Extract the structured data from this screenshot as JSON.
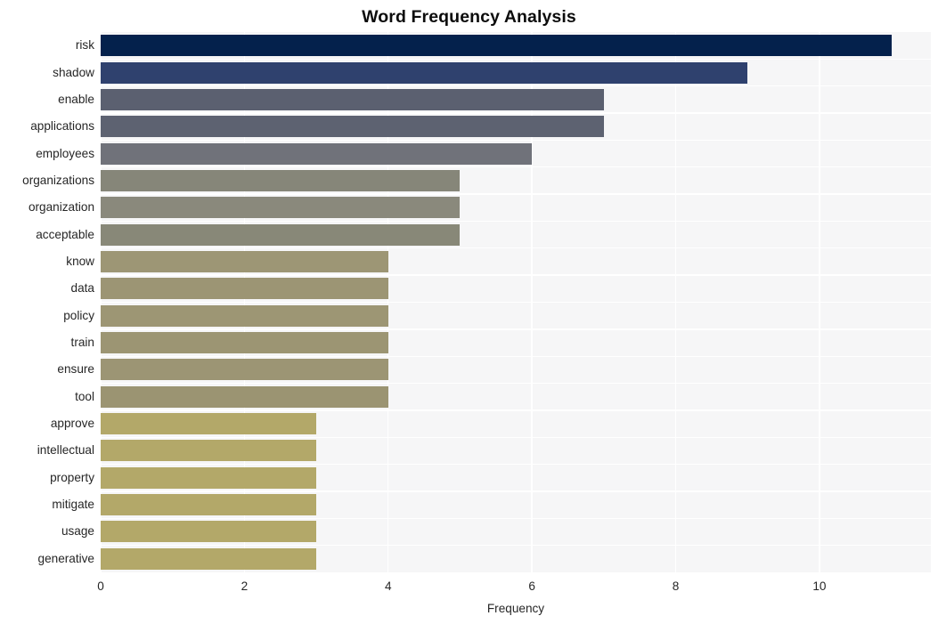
{
  "chart_data": {
    "type": "bar",
    "orientation": "horizontal",
    "title": "Word Frequency Analysis",
    "xlabel": "Frequency",
    "ylabel": "",
    "xlim": [
      0,
      11.55
    ],
    "xticks": [
      0,
      2,
      4,
      6,
      8,
      10
    ],
    "xticklabels": [
      "0",
      "2",
      "4",
      "6",
      "8",
      "10"
    ],
    "grid": "vertical-only",
    "legend": null,
    "background": "#f6f6f7",
    "gridline_color": "#ffffff",
    "categories": [
      "risk",
      "shadow",
      "enable",
      "applications",
      "employees",
      "organizations",
      "organization",
      "acceptable",
      "know",
      "data",
      "policy",
      "train",
      "ensure",
      "tool",
      "approve",
      "intellectual",
      "property",
      "mitigate",
      "usage",
      "generative"
    ],
    "values": [
      11,
      9,
      7,
      7,
      6,
      5,
      5,
      5,
      4,
      4,
      4,
      4,
      4,
      4,
      3,
      3,
      3,
      3,
      3,
      3
    ],
    "colors": [
      "#04214c",
      "#2f416e",
      "#5b6070",
      "#5d6271",
      "#70727a",
      "#868679",
      "#8a897c",
      "#888878",
      "#9d9675",
      "#9c9574",
      "#9d9674",
      "#9c9573",
      "#9c9574",
      "#9b9472",
      "#b3a869",
      "#b3a869",
      "#b3a869",
      "#b3a869",
      "#b3a869",
      "#b3a869"
    ]
  }
}
